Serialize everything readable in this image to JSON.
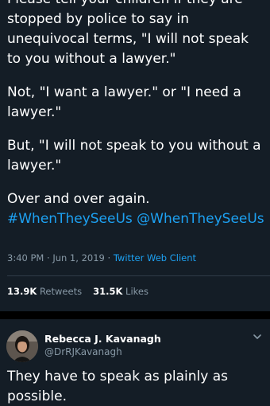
{
  "tweet": {
    "paragraphs": [
      "Please tell your children if they are stopped by police to say in unequivocal terms, \"I will not speak to you without a lawyer.\"",
      "Not, \"I want a lawyer.\" or \"I need a lawyer.\"",
      "But, \"I will not speak to you without a lawyer.\"",
      "Over and over again."
    ],
    "hashtag_1": "#WhenTheySeeUs",
    "hashtag_2": "@WhenTheySeeUs",
    "time": "3:40 PM",
    "separator": " · ",
    "date": "Jun 1, 2019",
    "source": "Twitter Web Client",
    "retweets_count": "13.9K",
    "retweets_label": "Retweets",
    "likes_count": "31.5K",
    "likes_label": "Likes"
  },
  "reply": {
    "display_name": "Rebecca J. Kavanagh",
    "handle": "@DrRJKavanagh",
    "text": "They have to speak as plainly as possible."
  },
  "colors": {
    "background": "#141d26",
    "page": "#000000",
    "accent": "#1da1f2",
    "muted": "#8899a6",
    "divider": "#2f3b47"
  },
  "icons": {
    "reply_menu": "chevron-down-icon"
  }
}
